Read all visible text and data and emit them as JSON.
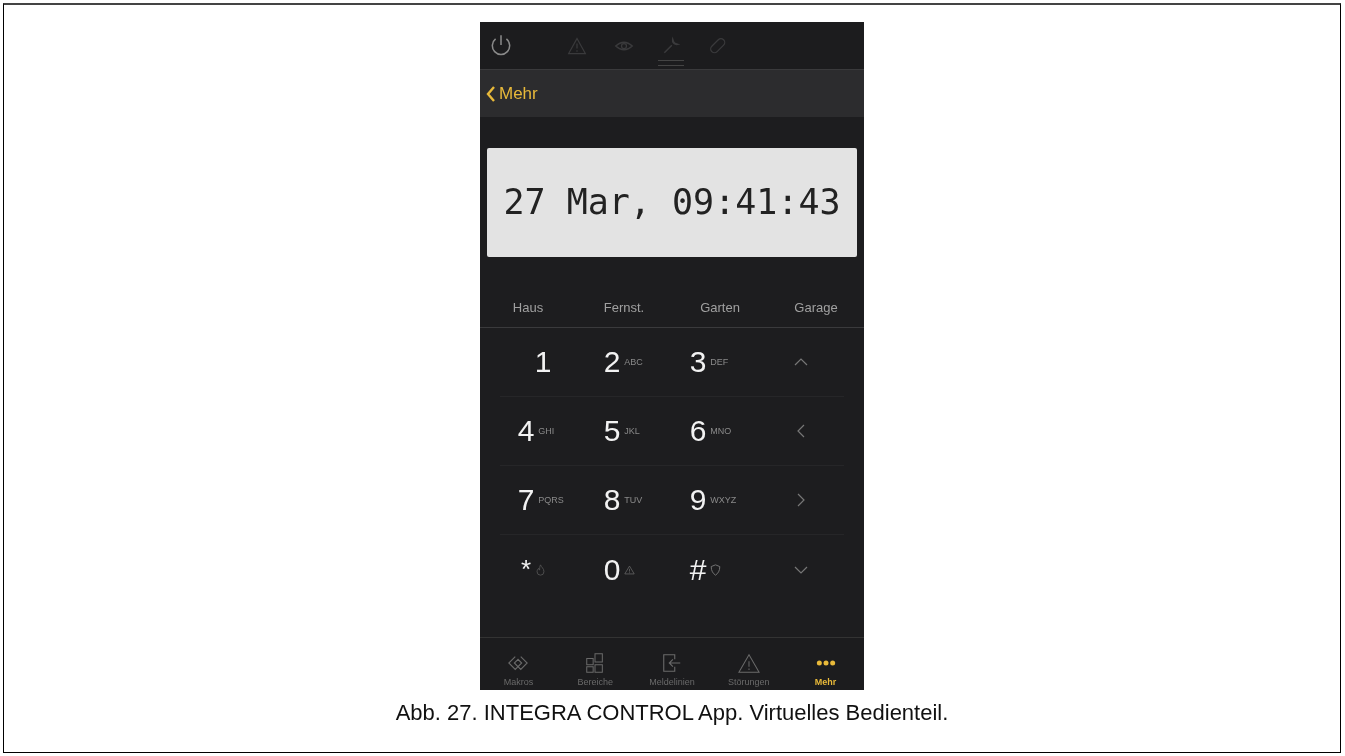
{
  "nav": {
    "back_label": "Mehr"
  },
  "display": {
    "text": "27 Mar, 09:41:43"
  },
  "partitions": [
    {
      "label": "Haus"
    },
    {
      "label": "Fernst."
    },
    {
      "label": "Garten"
    },
    {
      "label": "Garage"
    }
  ],
  "keys": [
    {
      "kind": "letters",
      "digit": "1"
    },
    {
      "kind": "letters",
      "digit": "2",
      "letters": "ABC"
    },
    {
      "kind": "letters",
      "digit": "3",
      "letters": "DEF"
    },
    {
      "kind": "up"
    },
    {
      "kind": "letters",
      "digit": "4",
      "letters": "GHI"
    },
    {
      "kind": "letters",
      "digit": "5",
      "letters": "JKL"
    },
    {
      "kind": "letters",
      "digit": "6",
      "letters": "MNO"
    },
    {
      "kind": "left"
    },
    {
      "kind": "letters",
      "digit": "7",
      "letters": "PQRS"
    },
    {
      "kind": "letters",
      "digit": "8",
      "letters": "TUV"
    },
    {
      "kind": "letters",
      "digit": "9",
      "letters": "WXYZ"
    },
    {
      "kind": "right"
    },
    {
      "kind": "fire",
      "digit": "*"
    },
    {
      "kind": "alert",
      "digit": "0"
    },
    {
      "kind": "guard",
      "digit": "#"
    },
    {
      "kind": "down"
    }
  ],
  "tabs": [
    {
      "kind": "macros",
      "label": "Makros",
      "selected": false
    },
    {
      "kind": "partitions",
      "label": "Bereiche",
      "selected": false
    },
    {
      "kind": "zones",
      "label": "Meldelinien",
      "selected": false
    },
    {
      "kind": "troubles",
      "label": "Störungen",
      "selected": false
    },
    {
      "kind": "more",
      "label": "Mehr",
      "selected": true
    }
  ],
  "caption": "Abb. 27. INTEGRA CONTROL App. Virtuelles Bedienteil."
}
